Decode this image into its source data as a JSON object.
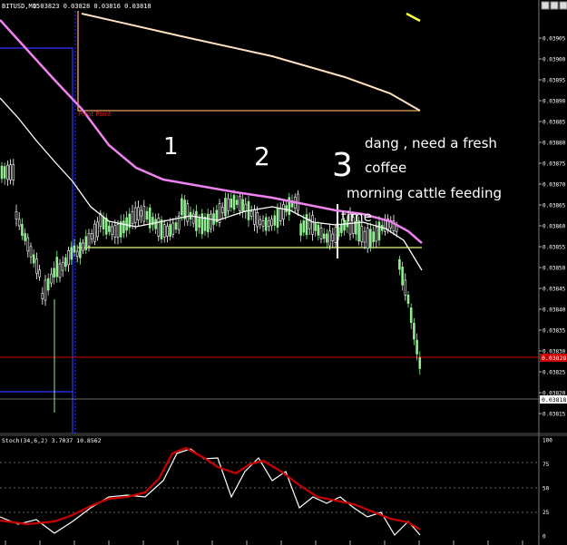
{
  "window": {
    "title": "BITUSD,M15",
    "ohlc": "0.03823 0.03828 0.03816 0.03818"
  },
  "main": {
    "price_axis_labels": [
      "0.03905",
      "0.03900",
      "0.03895",
      "0.03890",
      "0.03885",
      "0.03880",
      "0.03875",
      "0.03870",
      "0.03865",
      "0.03860",
      "0.03855",
      "0.03850",
      "0.03845",
      "0.03840",
      "0.03835",
      "0.03830",
      "0.03825",
      "0.03820",
      "0.03815"
    ],
    "red_line_price_tag": "0.03828",
    "current_price_tag": "0.03818",
    "pivot_label": "Pivot Point",
    "annotation_numbers": [
      "1",
      "2",
      "3"
    ],
    "annotation_text": [
      "dang , need a fresh",
      "coffee",
      "morning cattle feeding",
      "time"
    ]
  },
  "sub": {
    "indicator_label": "Stoch(34,6,2) 3.7037 10.8562",
    "levels": [
      "100",
      "75",
      "50",
      "25",
      "0"
    ]
  },
  "colors": {
    "background": "#000000",
    "bull_candle": "#90ee90",
    "bear_candle": "#ffffff",
    "ma_violet": "#ee82ee",
    "ma_white": "#ffffff",
    "pivot_line": "#f4a460",
    "support_line": "#e0ff80",
    "red_level": "#cc0000",
    "box_blue": "#3232ff",
    "stoch_main": "#ffffff",
    "stoch_signal": "#cc0000"
  }
}
